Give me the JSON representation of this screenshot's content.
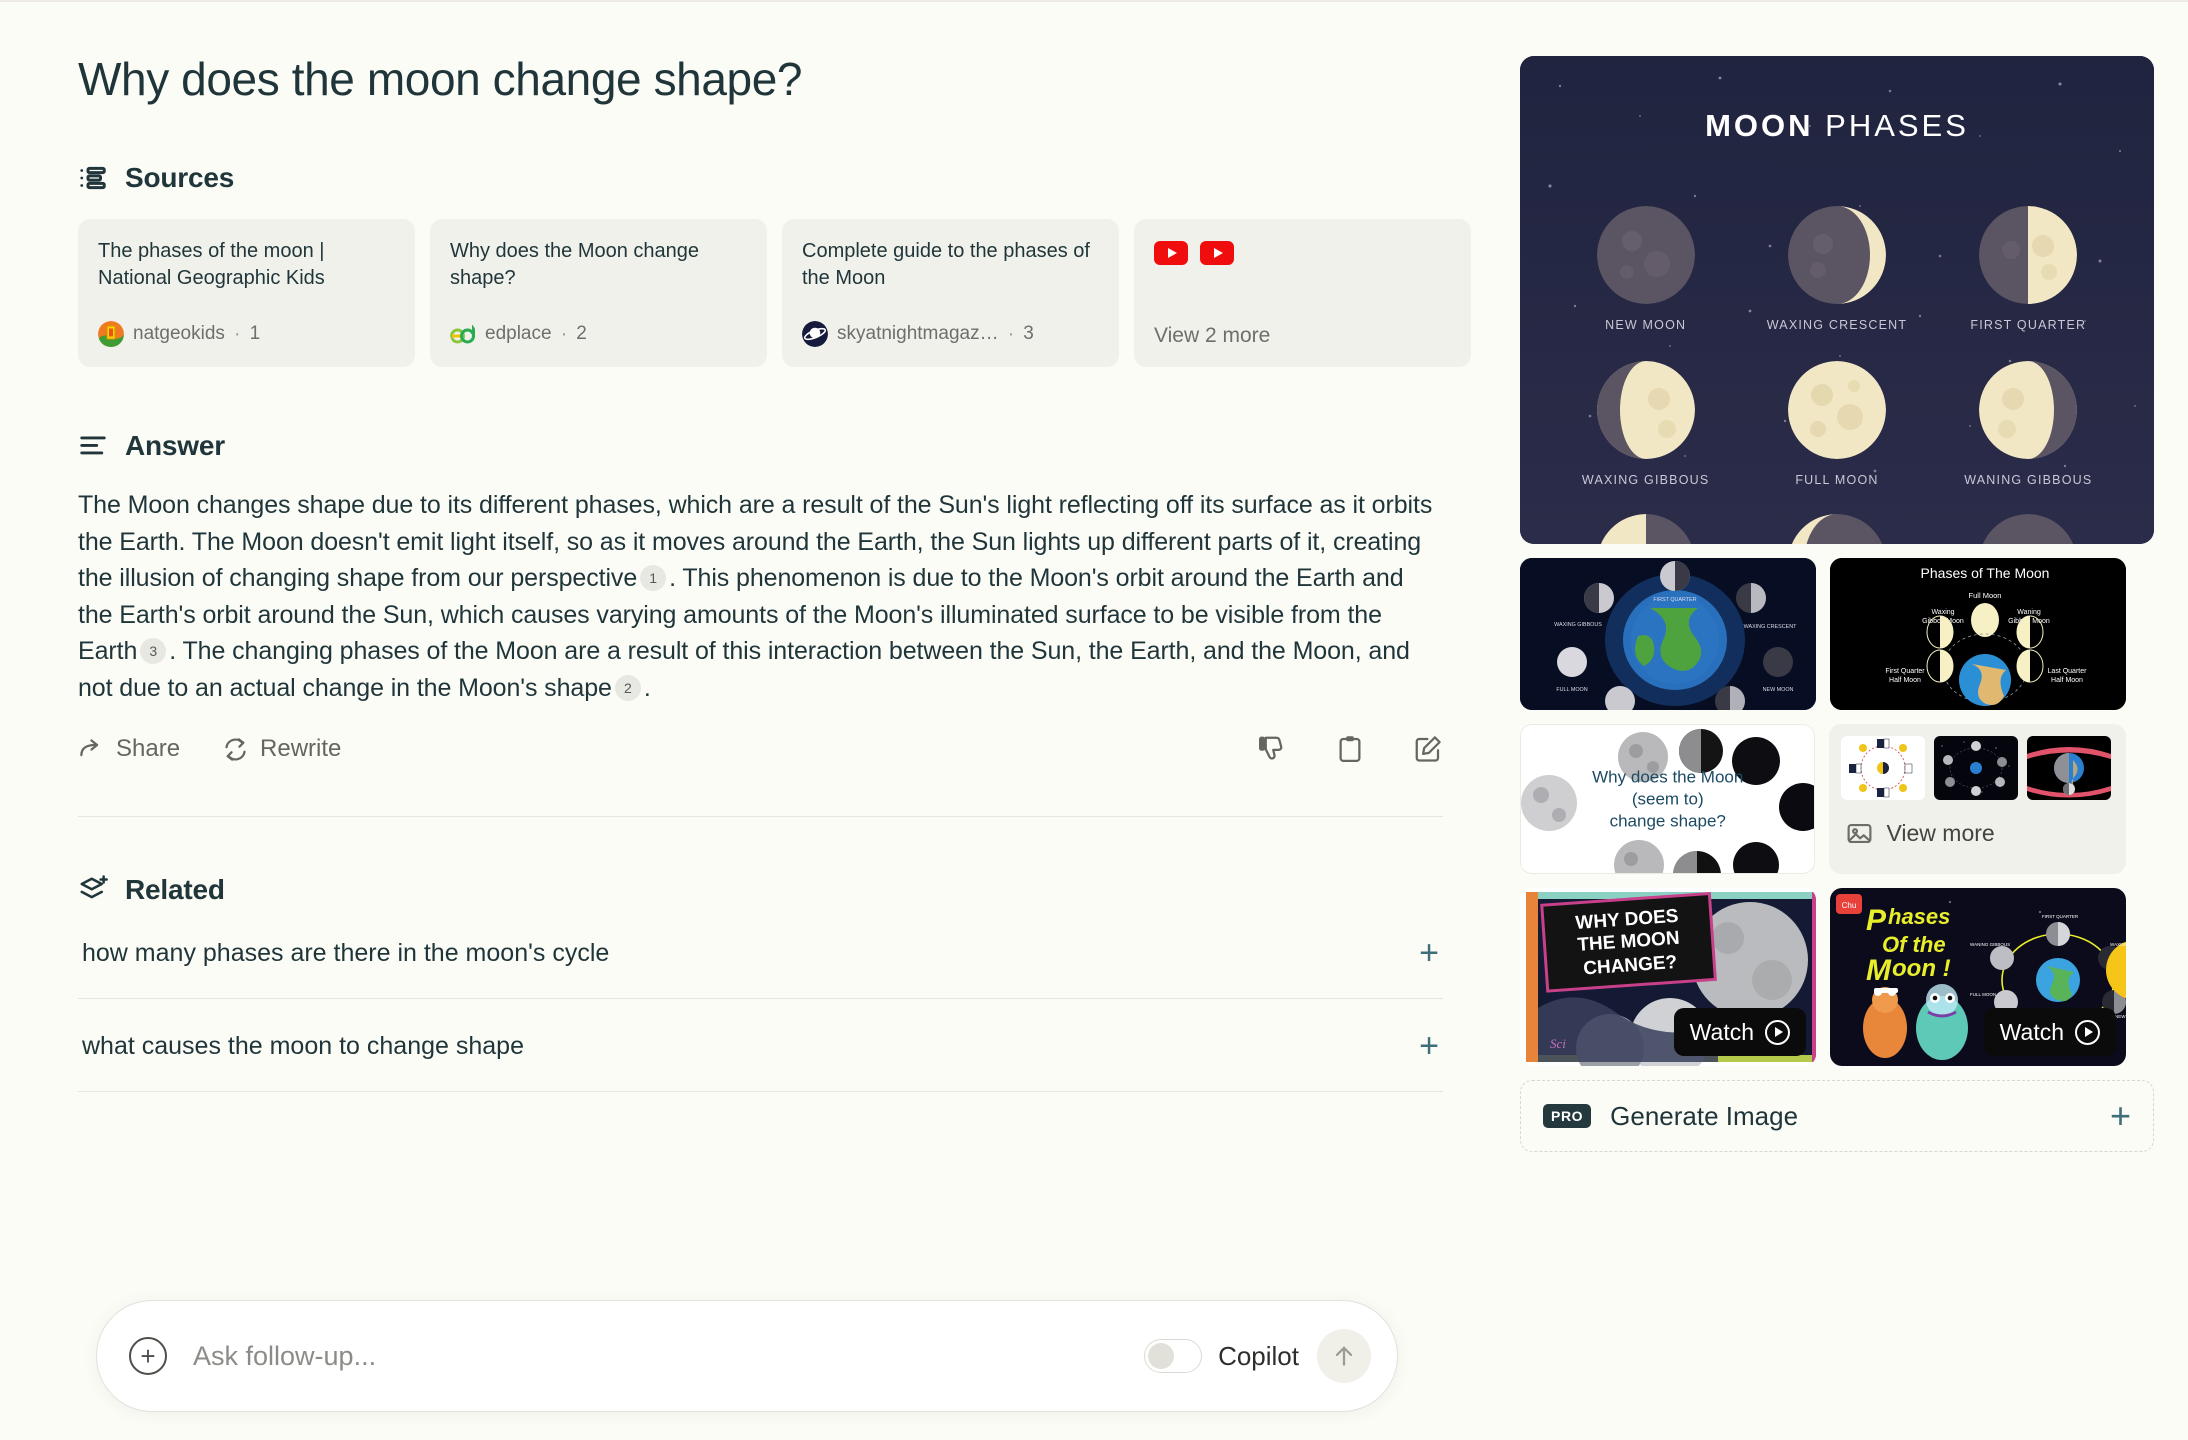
{
  "page_title": "Why does the moon change shape?",
  "sources": {
    "heading": "Sources",
    "cards": [
      {
        "title": "The phases of the moon | National Geographic Kids",
        "site": "natgeokids",
        "index": "1",
        "favicon": "natgeo-favicon"
      },
      {
        "title": "Why does the Moon change shape?",
        "site": "edplace",
        "index": "2",
        "favicon": "edplace-favicon"
      },
      {
        "title": "Complete guide to the phases of the Moon",
        "site": "skyatnightmagaz…",
        "index": "3",
        "favicon": "skyatnight-favicon"
      }
    ],
    "more_card": {
      "label": "View 2 more",
      "icons": [
        "youtube-icon",
        "youtube-icon"
      ]
    }
  },
  "answer": {
    "heading": "Answer",
    "paragraph_parts": [
      "The Moon changes shape due to its different phases, which are a result of the Sun's light reflecting off its surface as it orbits the Earth. The Moon doesn't emit light itself, so as it moves around the Earth, the Sun lights up different parts of it, creating the illusion of changing shape from our perspective",
      ". This phenomenon is due to the Moon's orbit around the Earth and the Earth's orbit around the Sun, which causes varying amounts of the Moon's illuminated surface to be visible from the Earth",
      ". The changing phases of the Moon are a result of this interaction between the Sun, the Earth, and the Moon, and not due to an actual change in the Moon's shape",
      "."
    ],
    "citations": [
      "1",
      "3",
      "2"
    ],
    "actions": {
      "share": "Share",
      "rewrite": "Rewrite",
      "dislike_icon": "thumbs-down-icon",
      "copy_icon": "clipboard-copy-icon",
      "edit_icon": "edit-pencil-icon"
    }
  },
  "related": {
    "heading": "Related",
    "items": [
      {
        "question": "how many phases are there in the moon's cycle"
      },
      {
        "question": "what causes the moon to change shape"
      }
    ]
  },
  "followup": {
    "placeholder": "Ask follow-up...",
    "value": "",
    "add_icon": "plus-circle-icon",
    "copilot_label": "Copilot",
    "copilot_on": false,
    "send_icon": "arrow-up-icon"
  },
  "media": {
    "hero": {
      "title_bold": "MOON",
      "title_light": "PHASES",
      "phases": [
        {
          "label": "NEW MOON",
          "lit": 0
        },
        {
          "label": "WAXING CRESCENT",
          "lit": 0.3
        },
        {
          "label": "FIRST QUARTER",
          "lit": 0.5
        },
        {
          "label": "WAXING GIBBOUS",
          "lit": 0.75
        },
        {
          "label": "FULL MOON",
          "lit": 1
        },
        {
          "label": "WANING GIBBOUS",
          "lit": 0.75
        }
      ]
    },
    "thumb_earth_orbit": {
      "labels": [
        "FIRST QUARTER",
        "WAXING GIBBOUS",
        "WAXING CRESCENT",
        "FULL MOON",
        "NEW MOON"
      ]
    },
    "thumb_phases_diagram": {
      "title": "Phases of The Moon",
      "labels": [
        "Full Moon",
        "Waxing Gibbos Moon",
        "Waning Gibbos Moon",
        "First Quarter Half Moon",
        "Last Quarter Half Moon"
      ]
    },
    "thumb_change_shape": {
      "caption": "Why does the Moon\n(seem to)\nchange shape?"
    },
    "view_more": {
      "label": "View more",
      "icon": "images-icon"
    },
    "videos": [
      {
        "overlay_title": "WHY DOES THE MOON CHANGE?",
        "watch_label": "Watch"
      },
      {
        "overlay_title": "Phases Of the Moon !",
        "watch_label": "Watch"
      }
    ],
    "generate_image": {
      "badge": "PRO",
      "label": "Generate Image",
      "plus": "+"
    }
  },
  "colors": {
    "text_dark": "#1f3539",
    "text_muted": "#6d6f6c",
    "bg": "#fcfcf7",
    "card_bg": "#f1f1ec",
    "accent_teal": "#3d6f78",
    "youtube_red": "#f00d0d"
  }
}
